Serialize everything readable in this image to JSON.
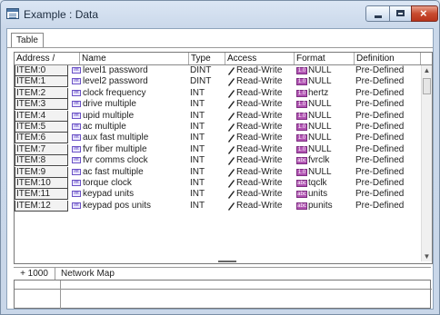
{
  "window": {
    "title": "Example : Data"
  },
  "tabs": {
    "active": "Table"
  },
  "columns": [
    "Address /",
    "Name",
    "Type",
    "Access",
    "Format",
    "Definition"
  ],
  "rows": [
    {
      "address": "ITEM:0",
      "name": "level1 password",
      "type": "DINT",
      "access": "Read-Write",
      "format_icon": "1.0",
      "format": "NULL",
      "definition": "Pre-Defined"
    },
    {
      "address": "ITEM:1",
      "name": "level2 password",
      "type": "DINT",
      "access": "Read-Write",
      "format_icon": "1.0",
      "format": "NULL",
      "definition": "Pre-Defined"
    },
    {
      "address": "ITEM:2",
      "name": "clock frequency",
      "type": "INT",
      "access": "Read-Write",
      "format_icon": "1.0",
      "format": "hertz",
      "definition": "Pre-Defined"
    },
    {
      "address": "ITEM:3",
      "name": "drive multiple",
      "type": "INT",
      "access": "Read-Write",
      "format_icon": "1.0",
      "format": "NULL",
      "definition": "Pre-Defined"
    },
    {
      "address": "ITEM:4",
      "name": "upid multiple",
      "type": "INT",
      "access": "Read-Write",
      "format_icon": "1.0",
      "format": "NULL",
      "definition": "Pre-Defined"
    },
    {
      "address": "ITEM:5",
      "name": "ac multiple",
      "type": "INT",
      "access": "Read-Write",
      "format_icon": "1.0",
      "format": "NULL",
      "definition": "Pre-Defined"
    },
    {
      "address": "ITEM:6",
      "name": "aux fast multiple",
      "type": "INT",
      "access": "Read-Write",
      "format_icon": "1.0",
      "format": "NULL",
      "definition": "Pre-Defined"
    },
    {
      "address": "ITEM:7",
      "name": "fvr fiber multiple",
      "type": "INT",
      "access": "Read-Write",
      "format_icon": "1.0",
      "format": "NULL",
      "definition": "Pre-Defined"
    },
    {
      "address": "ITEM:8",
      "name": "fvr comms clock",
      "type": "INT",
      "access": "Read-Write",
      "format_icon": "abc",
      "format": "fvrclk",
      "definition": "Pre-Defined"
    },
    {
      "address": "ITEM:9",
      "name": "ac fast multiple",
      "type": "INT",
      "access": "Read-Write",
      "format_icon": "1.0",
      "format": "NULL",
      "definition": "Pre-Defined"
    },
    {
      "address": "ITEM:10",
      "name": "torque clock",
      "type": "INT",
      "access": "Read-Write",
      "format_icon": "abc",
      "format": "tqclk",
      "definition": "Pre-Defined"
    },
    {
      "address": "ITEM:11",
      "name": "keypad units",
      "type": "INT",
      "access": "Read-Write",
      "format_icon": "abc",
      "format": "units",
      "definition": "Pre-Defined"
    },
    {
      "address": "ITEM:12",
      "name": "keypad pos units",
      "type": "INT",
      "access": "Read-Write",
      "format_icon": "abc",
      "format": "punits",
      "definition": "Pre-Defined"
    }
  ],
  "lower_panel": {
    "address": "+ 1000",
    "title": "Network Map"
  },
  "colors": {
    "accent": "#b255b3",
    "close": "#c84b2f"
  },
  "icons": {
    "int": "int-type-icon",
    "pen": "pen-icon"
  }
}
